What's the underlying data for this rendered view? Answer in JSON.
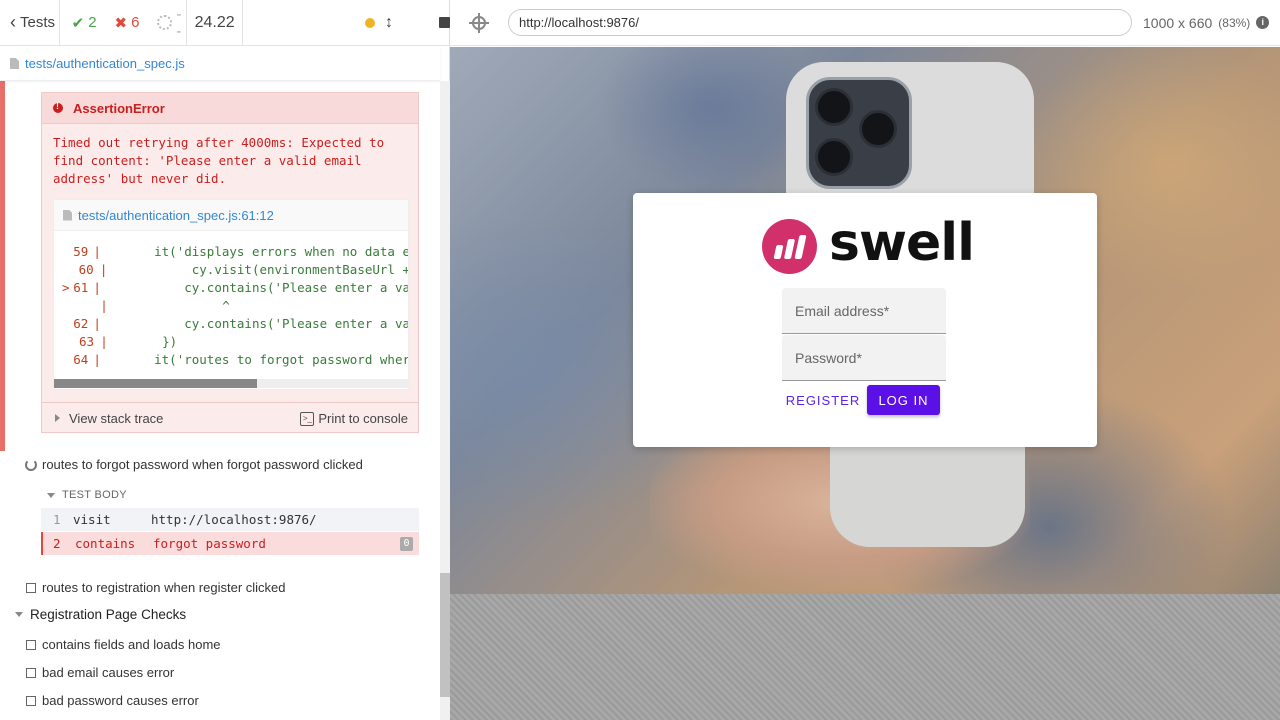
{
  "stats": {
    "tests_label": "Tests",
    "passed": "2",
    "failed": "6",
    "pending": "--",
    "duration": "24.22"
  },
  "spec_file": "tests/authentication_spec.js",
  "error": {
    "title": "AssertionError",
    "message": "Timed out retrying after 4000ms: Expected to find content: 'Please enter a valid email address' but never did.",
    "code_file": "tests/authentication_spec.js:61:12",
    "code_lines": [
      {
        "marker": "",
        "num": "59",
        "src": "    it('displays errors when no data e"
      },
      {
        "marker": "",
        "num": "60",
        "src": "        cy.visit(environmentBaseUrl +"
      },
      {
        "marker": ">",
        "num": "61",
        "src": "        cy.contains('Please enter a va"
      },
      {
        "marker": "",
        "num": "",
        "src": "            ^"
      },
      {
        "marker": "",
        "num": "62",
        "src": "        cy.contains('Please enter a va"
      },
      {
        "marker": "",
        "num": "63",
        "src": "    })"
      },
      {
        "marker": "",
        "num": "64",
        "src": "    it('routes to forgot password wher"
      }
    ],
    "view_stack_trace": "View stack trace",
    "print_to_console": "Print to console"
  },
  "tests": {
    "running_test": "routes to forgot password when forgot password clicked",
    "test_body_label": "TEST BODY",
    "commands": [
      {
        "num": "1",
        "name": "visit",
        "arg": "http://localhost:9876/"
      },
      {
        "num": "2",
        "name": "contains",
        "arg": "forgot password",
        "badge": "0"
      }
    ],
    "registration_test": "routes to registration when register clicked",
    "suite": "Registration Page Checks",
    "suite_tests": [
      "contains fields and loads home",
      "bad email causes error",
      "bad password causes error"
    ]
  },
  "browser": {
    "url": "http://localhost:9876/",
    "viewport": "1000 x 660",
    "zoom": "(83%)"
  },
  "app": {
    "logo_text": "swell",
    "email_placeholder": "Email address*",
    "password_placeholder": "Password*",
    "register_label": "REGISTER",
    "login_label": "LOG IN"
  }
}
